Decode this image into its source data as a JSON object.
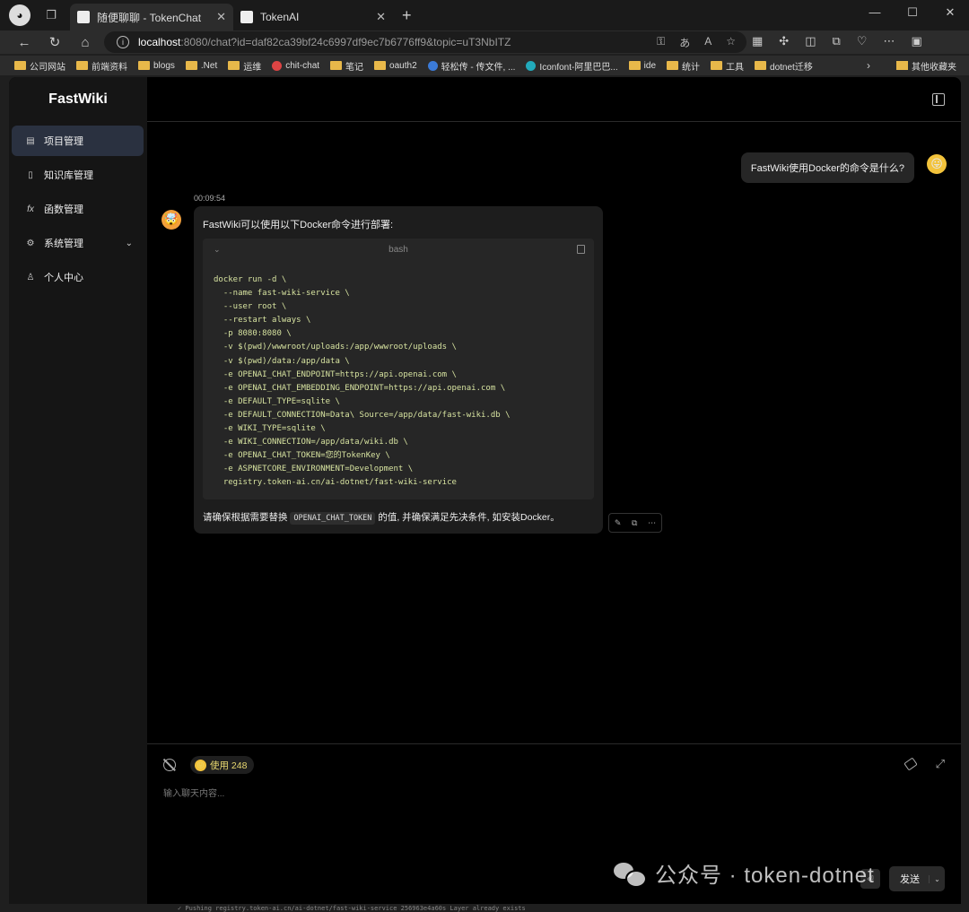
{
  "browser": {
    "tabs": [
      {
        "label": "随便聊聊 - TokenChat",
        "active": true
      },
      {
        "label": "TokenAI",
        "active": false
      }
    ],
    "new_tab": "+",
    "window_controls": [
      "—",
      "☐",
      "✕"
    ],
    "address": {
      "host": "localhost",
      "rest": ":8080/chat?id=daf82ca39bf24c6997df9ec7b6776ff9&topic=uT3NbITZ"
    },
    "bookmarks": [
      "公司网站",
      "前端资料",
      "blogs",
      ".Net",
      "运维",
      "chit-chat",
      "笔记",
      "oauth2",
      "轻松传 - 传文件, ...",
      "Iconfont-阿里巴巴...",
      "ide",
      "统计",
      "工具",
      "dotnet迁移"
    ],
    "bookmarks_other": "其他收藏夹"
  },
  "sidebar": {
    "brand": "FastWiki",
    "items": [
      {
        "label": "项目管理",
        "icon": "project-icon",
        "active": true
      },
      {
        "label": "知识库管理",
        "icon": "document-icon",
        "active": false
      },
      {
        "label": "函数管理",
        "icon": "function-icon",
        "active": false
      },
      {
        "label": "系统管理",
        "icon": "gear-icon",
        "active": false,
        "expandable": true
      },
      {
        "label": "个人中心",
        "icon": "user-icon",
        "active": false
      }
    ]
  },
  "chat": {
    "user_message": "FastWiki使用Docker的命令是什么?",
    "timestamp": "00:09:54",
    "bot_intro": "FastWiki可以使用以下Docker命令进行部署:",
    "code_lang": "bash",
    "code_lines": [
      "docker run -d \\",
      "  --name fast-wiki-service \\",
      "  --user root \\",
      "  --restart always \\",
      "  -p 8080:8080 \\",
      "  -v $(pwd)/wwwroot/uploads:/app/wwwroot/uploads \\",
      "  -v $(pwd)/data:/app/data \\",
      "  -e OPENAI_CHAT_ENDPOINT=https://api.openai.com \\",
      "  -e OPENAI_CHAT_EMBEDDING_ENDPOINT=https://api.openai.com \\",
      "  -e DEFAULT_TYPE=sqlite \\",
      "  -e DEFAULT_CONNECTION=Data\\ Source=/app/data/fast-wiki.db \\",
      "  -e WIKI_TYPE=sqlite \\",
      "  -e WIKI_CONNECTION=/app/data/wiki.db \\",
      "  -e OPENAI_CHAT_TOKEN=您的TokenKey \\",
      "  -e ASPNETCORE_ENVIRONMENT=Development \\",
      "  registry.token-ai.cn/ai-dotnet/fast-wiki-service"
    ],
    "bot_outro_before": "请确保根据需要替换 ",
    "bot_outro_code": "OPENAI_CHAT_TOKEN",
    "bot_outro_after": " 的值, 并确保满足先决条件, 如安装Docker。"
  },
  "composer": {
    "usage_label": "使用 248",
    "placeholder": "输入聊天内容...",
    "send_label": "发送"
  },
  "watermark": "公众号 · token-dotnet",
  "terminal_line": "✓ Pushing registry.token-ai.cn/ai-dotnet/fast-wiki-service  256963e4a60s Layer already exists"
}
